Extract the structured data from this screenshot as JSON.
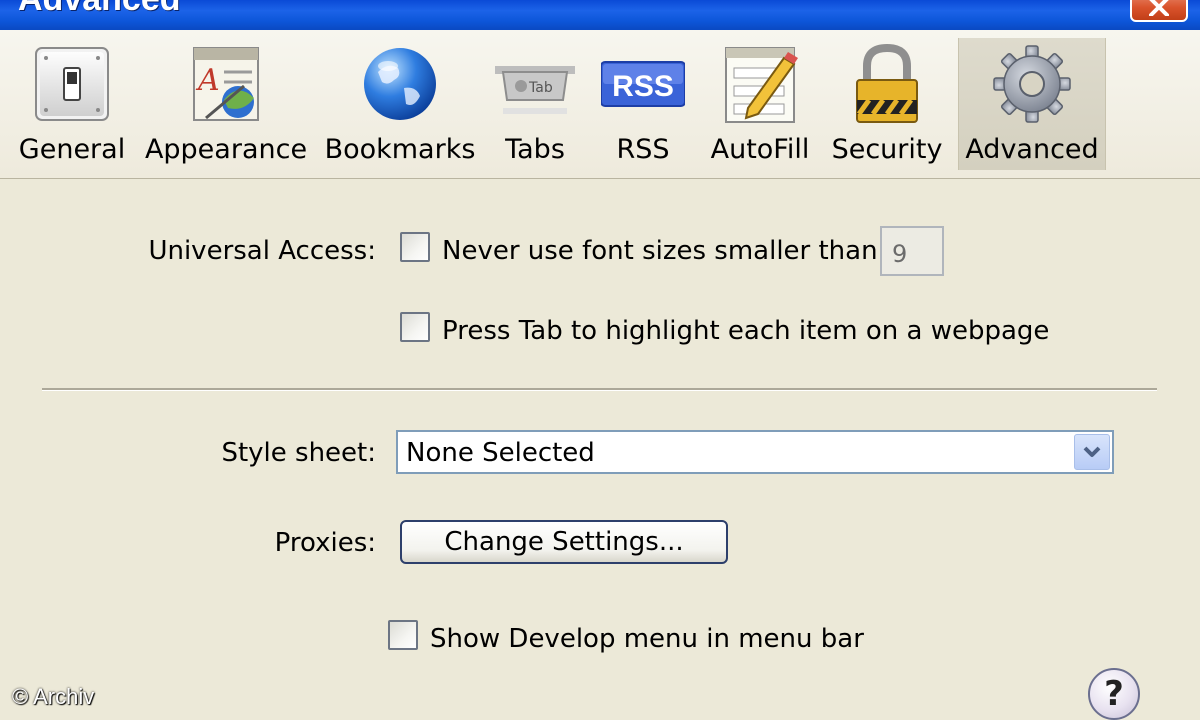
{
  "window": {
    "title": "Advanced"
  },
  "toolbar": {
    "items": [
      {
        "label": "General",
        "icon": "toggle-switch-icon"
      },
      {
        "label": "Appearance",
        "icon": "appearance-icon"
      },
      {
        "label": "Bookmarks",
        "icon": "globe-icon"
      },
      {
        "label": "Tabs",
        "icon": "tabs-icon",
        "icon_text": "Tab"
      },
      {
        "label": "RSS",
        "icon": "rss-icon",
        "icon_text": "RSS"
      },
      {
        "label": "AutoFill",
        "icon": "autofill-pencil-icon"
      },
      {
        "label": "Security",
        "icon": "padlock-icon"
      },
      {
        "label": "Advanced",
        "icon": "gear-icon",
        "active": true
      }
    ]
  },
  "universal_access": {
    "label": "Universal Access:",
    "font_size_checkbox": {
      "label": "Never use font sizes smaller than",
      "checked": false
    },
    "font_size_value": "9",
    "tab_highlight_checkbox": {
      "label": "Press Tab to highlight each item on a webpage",
      "checked": false
    }
  },
  "style_sheet": {
    "label": "Style sheet:",
    "selected": "None Selected"
  },
  "proxies": {
    "label": "Proxies:",
    "button_label": "Change Settings..."
  },
  "develop_menu": {
    "label": "Show Develop menu in menu bar",
    "checked": false
  },
  "help": {
    "label": "?"
  },
  "watermark": "© Archiv",
  "colors": {
    "titlebar": "#0a4ad6",
    "close_button": "#d9532c",
    "dialog_background": "#ece9d8",
    "select_border": "#7f9db9"
  }
}
